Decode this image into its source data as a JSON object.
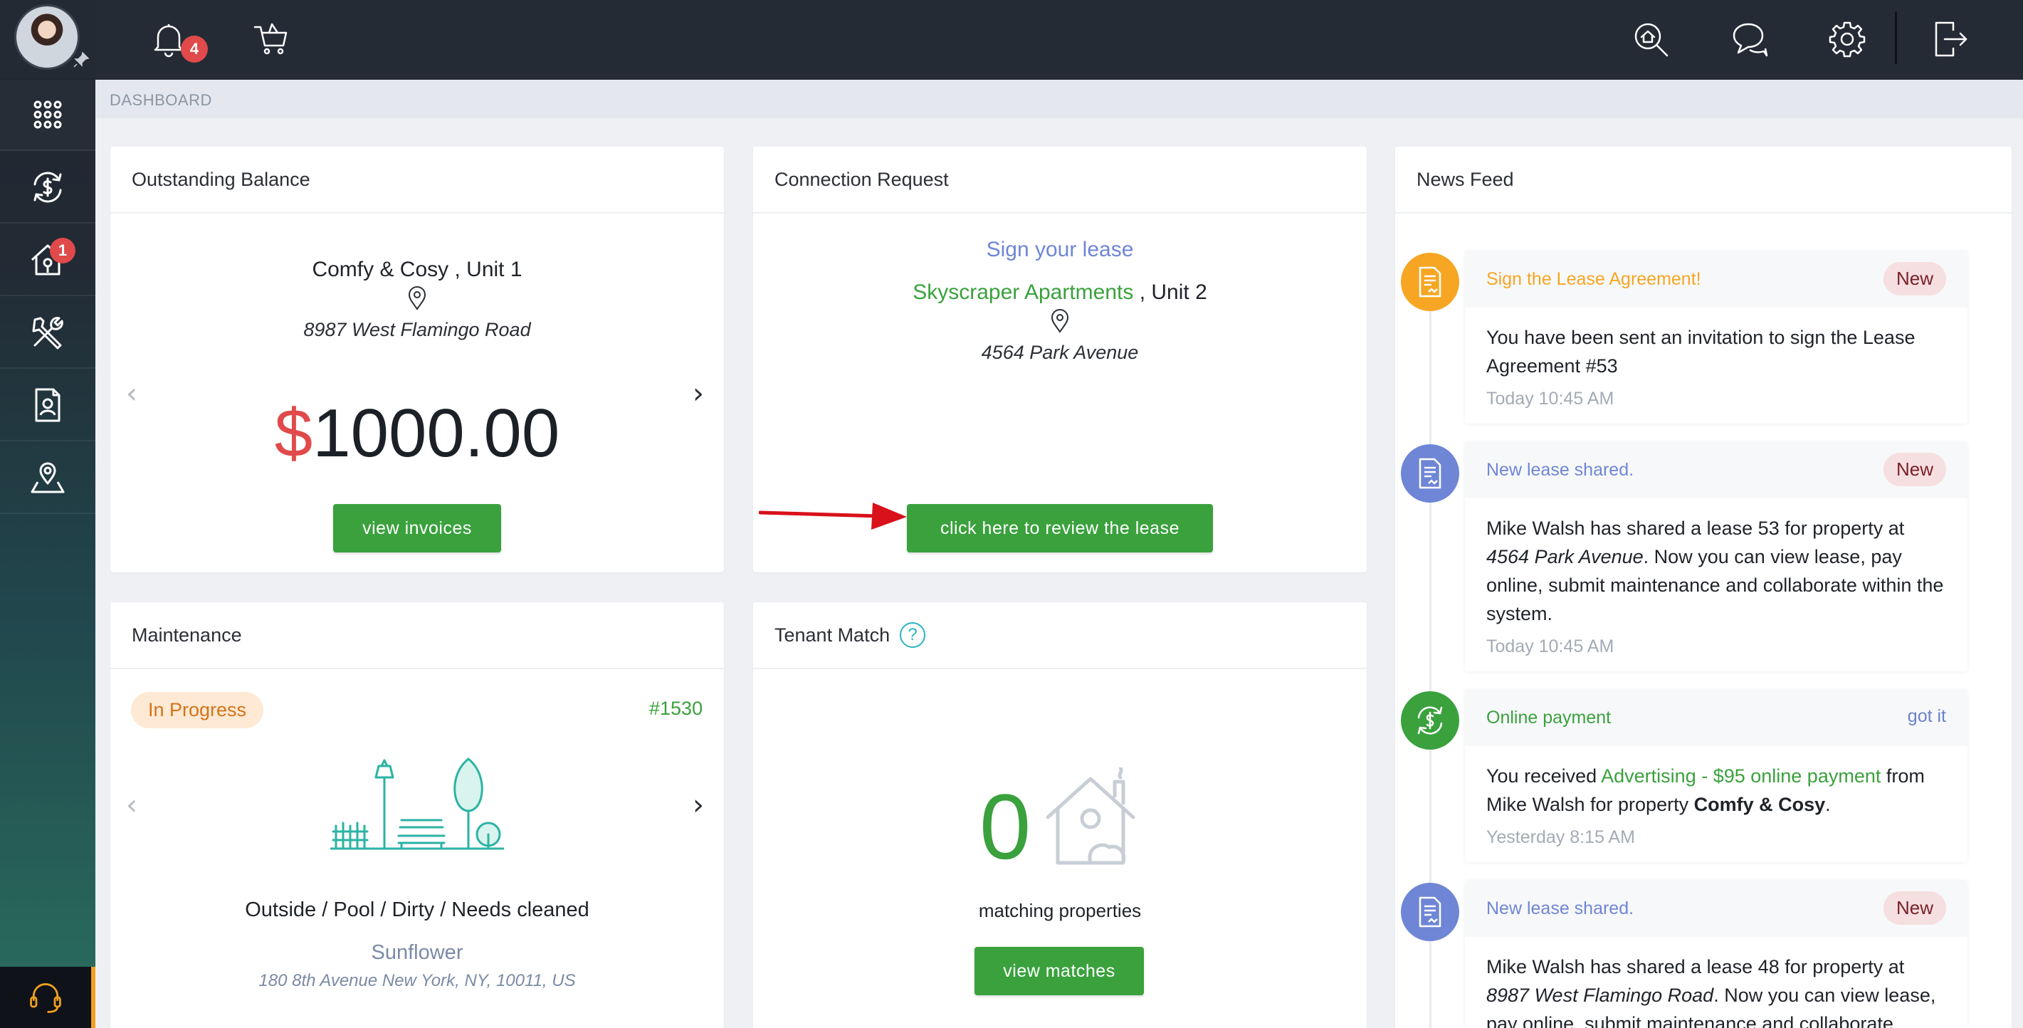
{
  "header": {
    "bell_count": "4",
    "icons": [
      "bell-icon",
      "cart-icon",
      "home-search-icon",
      "chat-icon",
      "gear-icon",
      "logout-icon"
    ]
  },
  "sidebar": {
    "items": [
      {
        "name": "dashboard",
        "icon": "grid-icon"
      },
      {
        "name": "payments",
        "icon": "money-cycle-icon"
      },
      {
        "name": "properties",
        "icon": "house-key-icon",
        "badge": "1"
      },
      {
        "name": "maintenance",
        "icon": "tools-icon"
      },
      {
        "name": "documents",
        "icon": "tenant-doc-icon"
      },
      {
        "name": "locations",
        "icon": "map-pin-icon"
      }
    ],
    "support_icon": "headset-icon"
  },
  "breadcrumb": "DASHBOARD",
  "outstanding": {
    "title": "Outstanding Balance",
    "property": "Comfy & Cosy , Unit 1",
    "address": "8987 West Flamingo Road",
    "currency": "$",
    "amount": "1000.00",
    "button": "view invoices"
  },
  "connection": {
    "title": "Connection Request",
    "headline": "Sign your lease",
    "property_name": "Skyscraper Apartments",
    "unit": " , Unit 2",
    "address": "4564 Park Avenue",
    "button": "click here to review the lease"
  },
  "maintenance": {
    "title": "Maintenance",
    "status": "In Progress",
    "ticket": "#1530",
    "issue": "Outside / Pool / Dirty / Needs cleaned",
    "property": "Sunflower",
    "address": "180 8th Avenue New York, NY, 10011, US"
  },
  "tenant_match": {
    "title": "Tenant Match",
    "help": "?",
    "count": "0",
    "label": "matching properties",
    "button": "view matches"
  },
  "news": {
    "title": "News Feed",
    "items": [
      {
        "title": "Sign the Lease Agreement!",
        "tag": "New",
        "body": "You have been sent an invitation to sign the Lease Agreement #53",
        "time": "Today 10:45 AM",
        "color": "#f6a623"
      },
      {
        "title": "New lease shared.",
        "tag": "New",
        "body_a": "Mike Walsh has shared a lease 53 for property at ",
        "body_b": "4564 Park Avenue",
        "body_c": ". Now you can view lease, pay online, submit maintenance and collaborate within the system.",
        "time": "Today 10:45 AM",
        "color": "#6f86d6"
      },
      {
        "title": "Online payment",
        "action": "got it",
        "body_a": "You received ",
        "body_b": "Advertising - $95 online payment",
        "body_c": " from Mike Walsh for property ",
        "body_d": "Comfy & Cosy",
        "body_e": ".",
        "time": "Yesterday 8:15 AM",
        "color": "#3aa13d"
      },
      {
        "title": "New lease shared.",
        "tag": "New",
        "body_a": "Mike Walsh has shared a lease 48 for property at ",
        "body_b": "8987 West Flamingo Road",
        "body_c": ". Now you can view lease, pay online, submit maintenance and collaborate",
        "color": "#6f86d6"
      }
    ]
  },
  "colors": {
    "accent_green": "#3aa13d",
    "accent_red": "#e04a4a",
    "topbar": "#252b35"
  }
}
